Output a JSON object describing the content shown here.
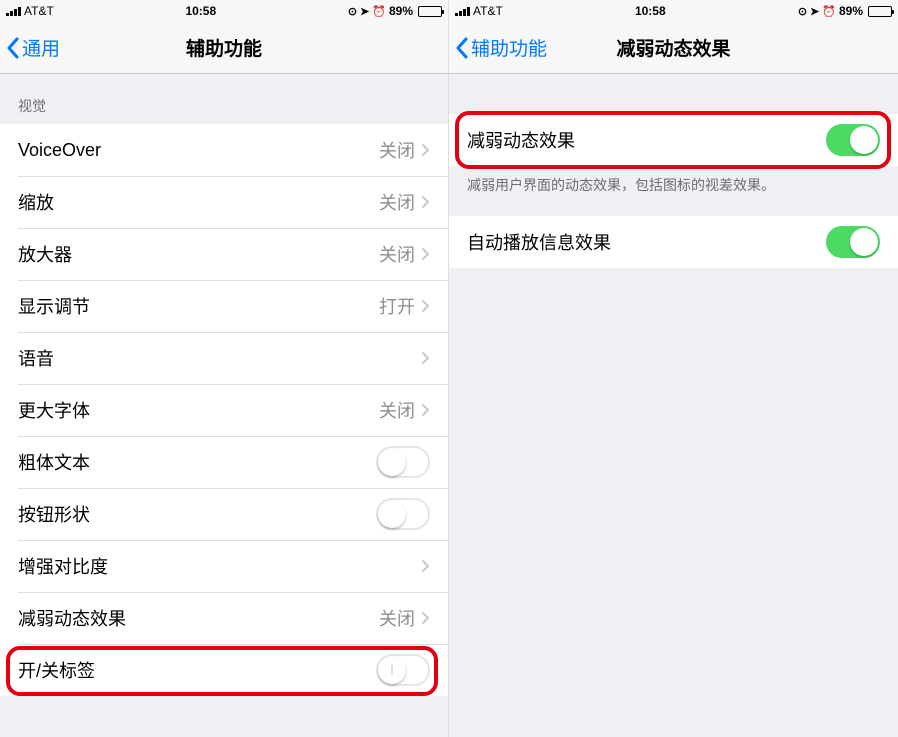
{
  "statusBar": {
    "carrier": "AT&T",
    "time": "10:58",
    "batteryPercent": "89%"
  },
  "leftPhone": {
    "backLabel": "通用",
    "title": "辅助功能",
    "sectionHeader": "视觉",
    "cells": {
      "voiceover": {
        "label": "VoiceOver",
        "value": "关闭"
      },
      "zoom": {
        "label": "缩放",
        "value": "关闭"
      },
      "magnifier": {
        "label": "放大器",
        "value": "关闭"
      },
      "display": {
        "label": "显示调节",
        "value": "打开"
      },
      "speech": {
        "label": "语音"
      },
      "largerText": {
        "label": "更大字体",
        "value": "关闭"
      },
      "boldText": {
        "label": "粗体文本"
      },
      "buttonShapes": {
        "label": "按钮形状"
      },
      "contrast": {
        "label": "增强对比度"
      },
      "reduceMotion": {
        "label": "减弱动态效果",
        "value": "关闭"
      },
      "onOffLabels": {
        "label": "开/关标签"
      }
    }
  },
  "rightPhone": {
    "backLabel": "辅助功能",
    "title": "减弱动态效果",
    "cells": {
      "reduceMotion": {
        "label": "减弱动态效果"
      },
      "autoPlay": {
        "label": "自动播放信息效果"
      }
    },
    "footerText": "减弱用户界面的动态效果，包括图标的视差效果。"
  }
}
